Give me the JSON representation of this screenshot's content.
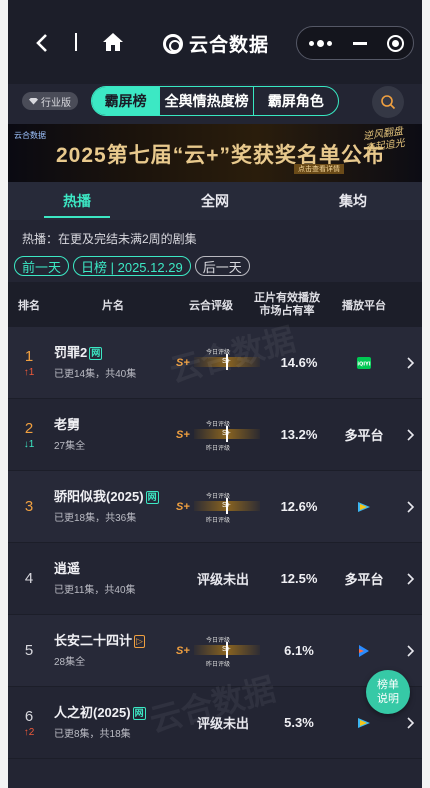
{
  "window": {
    "brand_title": "云合数据"
  },
  "tabbar": {
    "version_badge": "行业版",
    "segments": [
      "霸屏榜",
      "全舆情热度榜",
      "霸屏角色"
    ],
    "active_segment": "霸屏榜"
  },
  "banner": {
    "logo_text": "云合数据",
    "title": "2025第七届“云+”奖获奖名单公布",
    "subtitle": "点击查看详情",
    "right_text": "逆风翻盘 奋起追光"
  },
  "list_tabs": [
    "热播",
    "全网",
    "集均"
  ],
  "active_list_tab": "热播",
  "description": "热播：在更及完结未满2周的剧集",
  "date_controls": {
    "prev": "前一天",
    "current": "日榜 | 2025.12.29",
    "next": "后一天"
  },
  "table": {
    "headers": {
      "rank": "排名",
      "name": "片名",
      "grade": "云合评级",
      "share_line1": "正片有效播放",
      "share_line2": "市场占有率",
      "platform": "播放平台"
    },
    "grade_labels": {
      "today": "今日评级",
      "yesterday": "昨日评级",
      "level": "S+"
    },
    "rows": [
      {
        "rank": "1",
        "delta": "↑1",
        "delta_dir": "up",
        "title": "罚罪2",
        "tag": "网",
        "eps": "已更14集，共40集",
        "grade": "S+",
        "grade_note": "today",
        "share": "14.6%",
        "platform": "iqiyi",
        "platform_text": ""
      },
      {
        "rank": "2",
        "delta": "↓1",
        "delta_dir": "down",
        "title": "老舅",
        "tag": "",
        "eps": "27集全",
        "grade": "S+",
        "grade_note": "both",
        "share": "13.2%",
        "platform": "multi",
        "platform_text": "多平台"
      },
      {
        "rank": "3",
        "delta": "",
        "delta_dir": "",
        "title": "骄阳似我(2025)",
        "tag": "网",
        "eps": "已更18集，共36集",
        "grade": "S+",
        "grade_note": "both",
        "share": "12.6%",
        "platform": "tencent",
        "platform_text": ""
      },
      {
        "rank": "4",
        "delta": "",
        "delta_dir": "",
        "title": "逍遥",
        "tag": "",
        "eps": "已更11集，共40集",
        "grade": "",
        "grade_note": "none",
        "grade_none": "评级未出",
        "share": "12.5%",
        "platform": "multi",
        "platform_text": "多平台"
      },
      {
        "rank": "5",
        "delta": "",
        "delta_dir": "",
        "title": "长安二十四计",
        "tag": "▷",
        "eps": "28集全",
        "grade": "S+",
        "grade_note": "both",
        "share": "6.1%",
        "platform": "youku",
        "platform_text": ""
      },
      {
        "rank": "6",
        "delta": "↑2",
        "delta_dir": "up",
        "title": "人之初(2025)",
        "tag": "网",
        "eps": "已更8集，共18集",
        "grade": "",
        "grade_note": "none",
        "grade_none": "评级未出",
        "share": "5.3%",
        "platform": "tencent",
        "platform_text": ""
      }
    ]
  },
  "fab": {
    "label_line1": "榜单",
    "label_line2": "说明"
  },
  "colors": {
    "accent": "#3ce8c4",
    "rank_top": "#f0a040",
    "up": "#f05a3a",
    "bg": "#232533"
  }
}
